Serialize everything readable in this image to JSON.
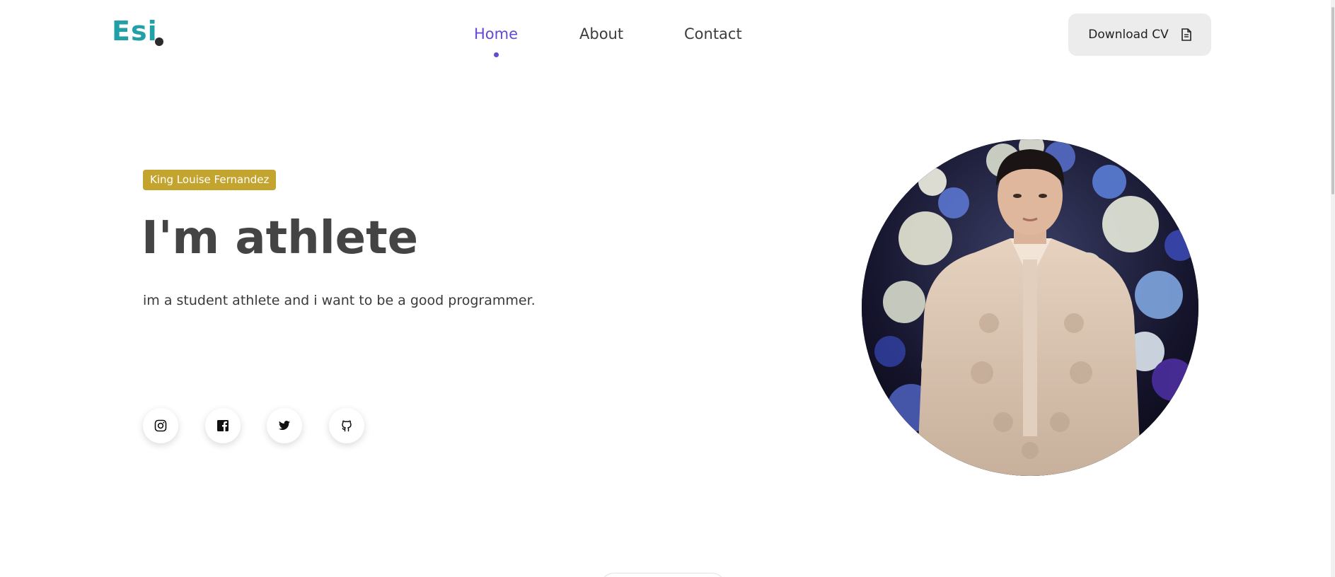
{
  "header": {
    "logo_text": "Esi",
    "nav": {
      "home": "Home",
      "about": "About",
      "contact": "Contact",
      "active": "home"
    },
    "download_label": "Download CV",
    "download_icon": "document-icon"
  },
  "hero": {
    "name_badge": "King Louise Fernandez",
    "title": "I'm athlete",
    "description": "im a student athlete and i want to be a good programmer."
  },
  "socials": [
    {
      "name": "instagram-icon"
    },
    {
      "name": "facebook-icon"
    },
    {
      "name": "twitter-icon"
    },
    {
      "name": "github-icon"
    }
  ],
  "colors": {
    "accent": "#6548d6",
    "logo": "#22a0a8",
    "badge": "#c3a42e"
  }
}
